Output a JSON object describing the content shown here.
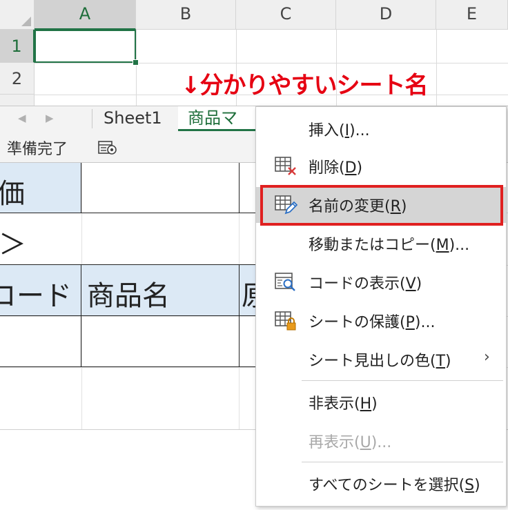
{
  "columns": [
    "A",
    "B",
    "C",
    "D",
    "E"
  ],
  "rows": [
    "1",
    "2"
  ],
  "annotation": "↓分かりやすいシート名",
  "tabs": {
    "prev_arrow": "◀",
    "next_arrow": "▶",
    "sheet1": "Sheet1",
    "active": "商品マス"
  },
  "status": {
    "text": "準備完了"
  },
  "lower_cells": {
    "r1c1": "価",
    "r2c1": "＞",
    "r3c1": "コード",
    "r3c2": "商品名",
    "r3c3": "原"
  },
  "menu": {
    "insert": {
      "pre": "挿入(",
      "key": "I",
      "post": ")..."
    },
    "delete": {
      "pre": "削除(",
      "key": "D",
      "post": ")"
    },
    "rename": {
      "pre": "名前の変更(",
      "key": "R",
      "post": ")"
    },
    "move_copy": {
      "pre": "移動またはコピー(",
      "key": "M",
      "post": ")..."
    },
    "view_code": {
      "pre": "コードの表示(",
      "key": "V",
      "post": ")"
    },
    "protect": {
      "pre": "シートの保護(",
      "key": "P",
      "post": ")..."
    },
    "tab_color": {
      "pre": "シート見出しの色(",
      "key": "T",
      "post": ")",
      "arrow": "›"
    },
    "hide": {
      "pre": "非表示(",
      "key": "H",
      "post": ")"
    },
    "unhide": {
      "pre": "再表示(",
      "key": "U",
      "post": ")..."
    },
    "select_all": {
      "pre": "すべてのシートを選択(",
      "key": "S",
      "post": ")"
    }
  },
  "colors": {
    "excel_green": "#217346",
    "annotation_red": "#e60012",
    "highlight_red": "#e02020",
    "header_blue": "#dce9f5"
  },
  "icons": [
    "insert-sheet-icon",
    "delete-sheet-icon",
    "rename-sheet-icon",
    "view-code-icon",
    "protect-sheet-icon",
    "status-macro-icon"
  ]
}
